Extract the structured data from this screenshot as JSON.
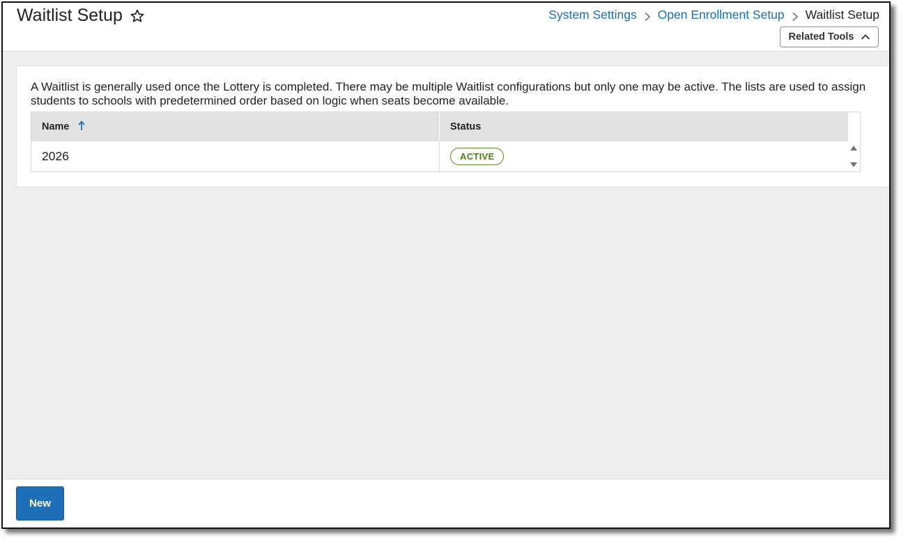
{
  "header": {
    "title": "Waitlist Setup",
    "breadcrumb": [
      {
        "label": "System Settings"
      },
      {
        "label": "Open Enrollment Setup"
      },
      {
        "label": "Waitlist Setup"
      }
    ],
    "related_tools_label": "Related Tools"
  },
  "main": {
    "description": "A Waitlist is generally used once the Lottery is completed. There may be multiple Waitlist configurations but only one may be active. The lists are used to assign students to schools with predetermined order based on logic when seats become available.",
    "table": {
      "columns": [
        "Name",
        "Status"
      ],
      "sort": {
        "column": "Name",
        "direction": "ascending"
      },
      "rows": [
        {
          "name": "2026",
          "status": "ACTIVE"
        }
      ]
    }
  },
  "footer": {
    "new_button_label": "New"
  },
  "colors": {
    "link": "#1a6fb5",
    "primary_button": "#1f6fb8",
    "active_badge": "#4a7a1f",
    "content_background": "#eeeeee",
    "table_header": "#e2e2e2"
  },
  "icons": {
    "favorite": "star-outline-icon",
    "breadcrumb_separator": "chevron-right-icon",
    "related_tools_toggle": "chevron-up-icon",
    "sort": "arrow-up-icon"
  }
}
